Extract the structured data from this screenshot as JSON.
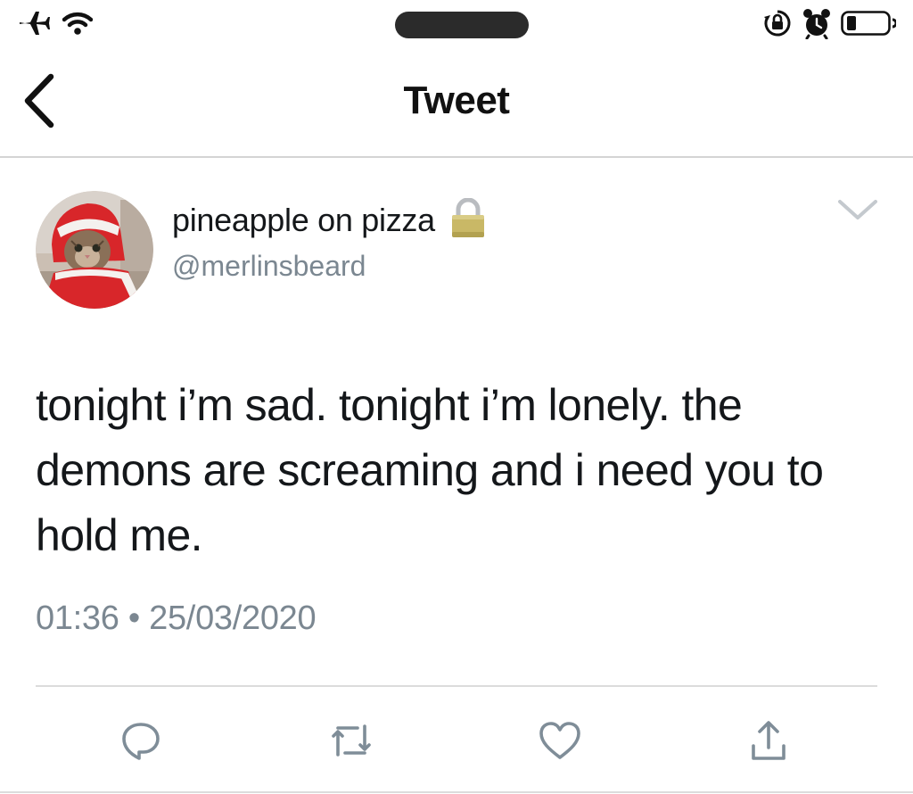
{
  "nav": {
    "title": "Tweet"
  },
  "tweet": {
    "display_name": "pineapple on pizza",
    "handle": "@merlinsbeard",
    "protected": true,
    "text": "tonight i’m sad. tonight i’m lonely. the demons are screaming and i need you to hold me.",
    "time": "01:36",
    "separator": "•",
    "date": "25/03/2020"
  },
  "icons": {
    "status_left": [
      "airplane-icon",
      "wifi-icon"
    ],
    "status_right": [
      "orientation-lock-icon",
      "alarm-icon",
      "battery-icon"
    ],
    "nav": [
      "back-chevron-icon"
    ],
    "header": [
      "lock-icon",
      "chevron-down-icon"
    ],
    "actions": [
      "reply-icon",
      "retweet-icon",
      "like-icon",
      "share-icon"
    ]
  },
  "colors": {
    "text": "#14171a",
    "secondary_text": "#7b8791",
    "action_icon": "#7f8d98",
    "divider": "#dcdcdc",
    "lock_gold": "#c9b866"
  }
}
